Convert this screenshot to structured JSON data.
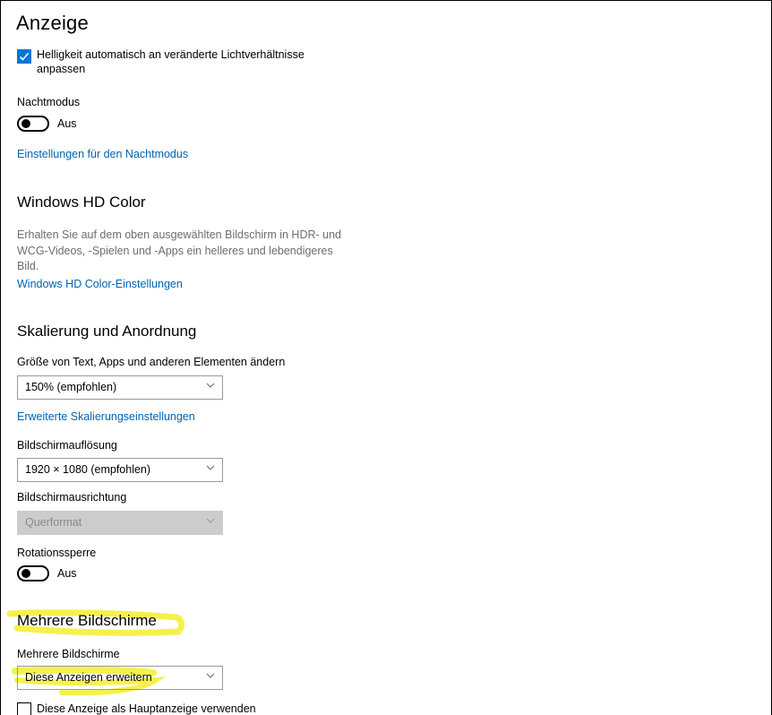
{
  "page_title": "Anzeige",
  "brightness": {
    "checked": true,
    "label_line1": "Helligkeit automatisch an veränderte Lichtverhältnisse",
    "label_line2": "anpassen"
  },
  "night_mode": {
    "label": "Nachtmodus",
    "state": "Aus",
    "settings_link": "Einstellungen für den Nachtmodus"
  },
  "hd_color": {
    "heading": "Windows HD Color",
    "desc_line1": "Erhalten Sie auf dem oben ausgewählten Bildschirm in HDR- und",
    "desc_line2": "WCG-Videos, -Spielen und -Apps ein helleres und lebendigeres",
    "desc_line3": "Bild.",
    "settings_link": "Windows HD Color-Einstellungen"
  },
  "scaling": {
    "heading": "Skalierung und Anordnung",
    "size_label": "Größe von Text, Apps und anderen Elementen ändern",
    "size_value": "150% (empfohlen)",
    "advanced_link": "Erweiterte Skalierungseinstellungen",
    "resolution_label": "Bildschirmauflösung",
    "resolution_value": "1920 × 1080 (empfohlen)",
    "orientation_label": "Bildschirmausrichtung",
    "orientation_value": "Querformat",
    "rotation_label": "Rotationssperre",
    "rotation_state": "Aus"
  },
  "multi": {
    "heading": "Mehrere Bildschirme",
    "label": "Mehrere Bildschirme",
    "value": "Diese Anzeigen erweitern",
    "main_display_checked": false,
    "main_display_label": "Diese Anzeige als Hauptanzeige verwenden"
  },
  "colors": {
    "accent": "#0078d7",
    "link": "#0063b1",
    "highlight": "#f3f03a"
  }
}
